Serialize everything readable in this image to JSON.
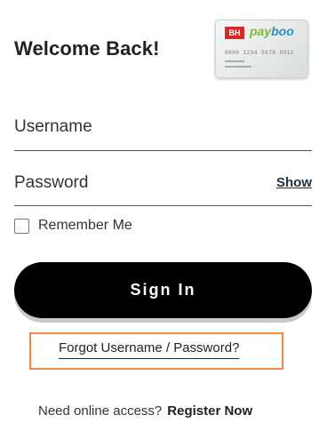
{
  "header": {
    "title": "Welcome Back!"
  },
  "card": {
    "bh_logo": "BH",
    "brand_part1": "pay",
    "brand_part2": "boo",
    "number": "0000 1234 5678 9012",
    "colors": {
      "bh_red": "#d32a2a",
      "pay_green": "#7cbf2a",
      "boo_blue": "#2a8fd0"
    }
  },
  "form": {
    "username_label": "Username",
    "password_label": "Password",
    "show_label": "Show",
    "remember_label": "Remember Me",
    "remember_checked": false,
    "signin_label": "Sign In"
  },
  "links": {
    "forgot_label": "Forgot Username / Password?",
    "register_prompt": "Need online access?",
    "register_label": "Register Now"
  },
  "highlight_color": "#f08a46"
}
